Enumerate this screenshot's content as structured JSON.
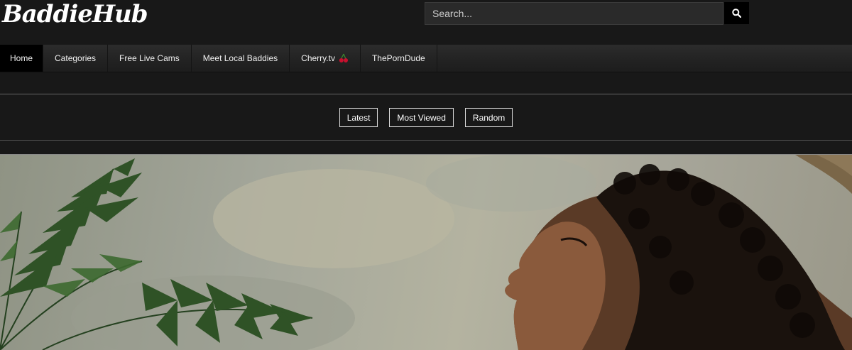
{
  "header": {
    "logo_text": "BaddieHub",
    "search_placeholder": "Search..."
  },
  "nav": {
    "items": [
      {
        "label": "Home",
        "active": true
      },
      {
        "label": "Categories"
      },
      {
        "label": "Free Live Cams"
      },
      {
        "label": "Meet Local Baddies"
      },
      {
        "label": "Cherry.tv"
      },
      {
        "label": "ThePornDude"
      }
    ]
  },
  "filters": [
    "Latest",
    "Most Viewed",
    "Random"
  ],
  "icons": {
    "search": "search-icon",
    "cherry": "cherry-icon"
  },
  "colors": {
    "background": "#181818",
    "accent": "#000000",
    "cherry": "#c8102e"
  }
}
